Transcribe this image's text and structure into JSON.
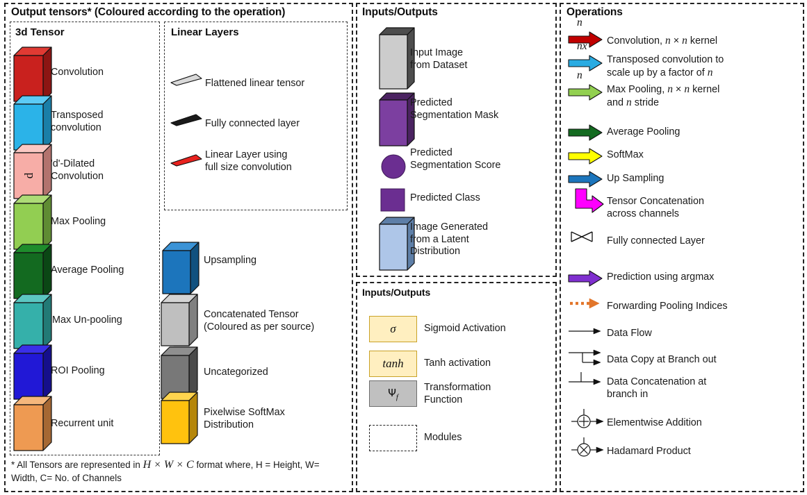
{
  "panels": {
    "output_tensors": {
      "title": "Output tensors* (Coloured according to the operation)",
      "footnote_1": "* All Tensors are represented in ",
      "footnote_math": "H × W × C",
      "footnote_2": " format where, H = Height, W= Width, C= No. of Channels",
      "sub_3d": {
        "title": "3d Tensor"
      },
      "sub_linear": {
        "title": "Linear Layers"
      }
    },
    "inputs_outputs_top": {
      "title": "Inputs/Outputs"
    },
    "inputs_outputs_bottom": {
      "title": "Inputs/Outputs"
    },
    "operations": {
      "title": "Operations"
    }
  },
  "tensors_3d": [
    {
      "label": "Convolution",
      "face": "#C9211E",
      "top": "#E03A33",
      "side": "#8C1513"
    },
    {
      "label": "Transposed\nconvolution",
      "face": "#2BB3E8",
      "top": "#5CCBF5",
      "side": "#1A7FA8"
    },
    {
      "label": "'d'-Dilated\nConvolution",
      "face": "#F7ADA7",
      "top": "#FBC8C3",
      "side": "#B3736E",
      "glyph": "d"
    },
    {
      "label": "Max Pooling",
      "face": "#92CE52",
      "top": "#ADDB76",
      "side": "#5F8C33"
    },
    {
      "label": "Average Pooling",
      "face": "#136A20",
      "top": "#1E8C2C",
      "side": "#0B4715"
    },
    {
      "label": "Max Un-pooling",
      "face": "#35B0AA",
      "top": "#5CC7C2",
      "side": "#227A76"
    },
    {
      "label": "ROI Pooling",
      "face": "#2118D6",
      "top": "#3A2FE8",
      "side": "#150F8C"
    },
    {
      "label": "Recurrent unit",
      "face": "#EE9A52",
      "top": "#F5B77C",
      "side": "#A66833"
    }
  ],
  "linear_layers": [
    {
      "label": "Flattened linear tensor",
      "face": "#D9D9D9",
      "side": "#AFAFAF"
    },
    {
      "label": "Fully connected layer",
      "face": "#1A1A1A",
      "side": "#000000"
    },
    {
      "label": "Linear Layer using\nfull size convolution",
      "face": "#E8221E",
      "side": "#A81412"
    }
  ],
  "misc_tensors": [
    {
      "label": "Upsampling",
      "face": "#1C75BC",
      "top": "#3B93D6",
      "side": "#11517F"
    },
    {
      "label": "Concatenated Tensor\n(Coloured as per source)",
      "face": "#BFBFBF",
      "top": "#D4D4D4",
      "side": "#808080",
      "second": true
    },
    {
      "label": "Uncategorized",
      "face": "#787878",
      "top": "#8F8F8F",
      "side": "#4A4A4A"
    },
    {
      "label": "Pixelwise SoftMax\nDistribution",
      "face": "#FFC20E",
      "top": "#FFD44E",
      "side": "#B5860A"
    }
  ],
  "io_top": [
    {
      "label": "Input Image\nfrom Dataset",
      "kind": "plate",
      "face": "#CCCCCC",
      "side": "#4D4D4D"
    },
    {
      "label": "Predicted\nSegmentation Mask",
      "kind": "plate",
      "face": "#7C3FA0",
      "side": "#4B2361"
    },
    {
      "label": "Predicted\nSegmentation Score",
      "kind": "circle",
      "face": "#6B2E91"
    },
    {
      "label": "Predicted Class",
      "kind": "square",
      "face": "#6B2E91"
    },
    {
      "label": "Image Generated\nfrom a Latent\nDistribution",
      "kind": "plate",
      "face": "#AEC6E8",
      "side": "#5E7FA8"
    }
  ],
  "io_bottom": [
    {
      "symbol": "σ",
      "label": "Sigmoid Activation",
      "fill": "#FFEFC0",
      "stroke": "#C9A227",
      "style": "solid"
    },
    {
      "symbol": "tanh",
      "label": "Tanh activation",
      "fill": "#FFEFC0",
      "stroke": "#C9A227",
      "style": "solid"
    },
    {
      "symbol": "Ψf",
      "label": "Transformation\nFunction",
      "fill": "#C0C0C0",
      "stroke": "#6E6E6E",
      "style": "solid"
    },
    {
      "symbol": "",
      "label": "Modules",
      "fill": "#FFFFFF",
      "stroke": "#222222",
      "style": "dashed"
    }
  ],
  "operations": [
    {
      "icon": "block-arrow",
      "color": "#C00000",
      "sup": "n",
      "label": "Convolution, n × n kernel",
      "label_parts": [
        "Convolution, ",
        "n",
        " × ",
        "n",
        " kernel"
      ]
    },
    {
      "icon": "block-arrow",
      "color": "#29ABE2",
      "sup": "nx",
      "label": "Transposed convolution to\nscale up by a factor of n"
    },
    {
      "icon": "block-arrow",
      "color": "#92D050",
      "sup": "n",
      "label": "Max Pooling, n × n kernel\nand n stride"
    },
    {
      "icon": "block-arrow",
      "color": "#136A20",
      "sup": "",
      "label": "Average Pooling"
    },
    {
      "icon": "block-arrow",
      "color": "#FFFF00",
      "sup": "",
      "label": "SoftMax"
    },
    {
      "icon": "block-arrow",
      "color": "#1C75BC",
      "sup": "",
      "label": "Up Sampling"
    },
    {
      "icon": "elbow-arrow",
      "color": "#FF00FF",
      "sup": "",
      "label": "Tensor Concatenation\nacross channels"
    },
    {
      "icon": "bowtie",
      "color": "#1A1A1A",
      "sup": "",
      "label": "Fully connected Layer"
    },
    {
      "icon": "block-arrow",
      "color": "#7F2FCF",
      "sup": "",
      "label": "Prediction using argmax"
    },
    {
      "icon": "dotted-arrow",
      "color": "#E2762B",
      "sup": "",
      "label": "Forwarding Pooling Indices"
    },
    {
      "icon": "line-arrow",
      "color": "#111111",
      "sup": "",
      "label": "Data Flow"
    },
    {
      "icon": "branch-out",
      "color": "#111111",
      "sup": "",
      "label": "Data Copy at Branch out"
    },
    {
      "icon": "branch-in",
      "color": "#111111",
      "sup": "",
      "label": "Data Concatenation at\nbranch in"
    },
    {
      "icon": "circle-plus",
      "color": "#111111",
      "sup": "",
      "label": "Elementwise Addition"
    },
    {
      "icon": "circle-times",
      "color": "#111111",
      "sup": "",
      "label": "Hadamard Product"
    }
  ]
}
